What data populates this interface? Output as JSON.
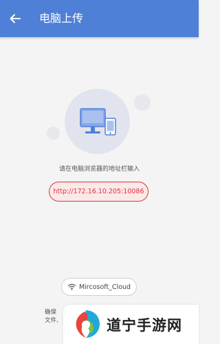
{
  "appbar": {
    "title": "电脑上传",
    "back_icon": "arrow-left-icon"
  },
  "main": {
    "illustration_icon": "monitor-phone-icon",
    "instruction": "请在电脑浏览器的地址栏输入",
    "url": "http://172.16.10.205:10086"
  },
  "wifi": {
    "icon": "wifi-icon",
    "network_name": "Mircosoft_Cloud"
  },
  "hint": {
    "line1": "确保",
    "line2": "文件,"
  },
  "watermark": {
    "text": "道宁手游网"
  },
  "colors": {
    "primary": "#4f80d8",
    "accent_red": "#d9363e",
    "background": "#f4f4f4"
  }
}
